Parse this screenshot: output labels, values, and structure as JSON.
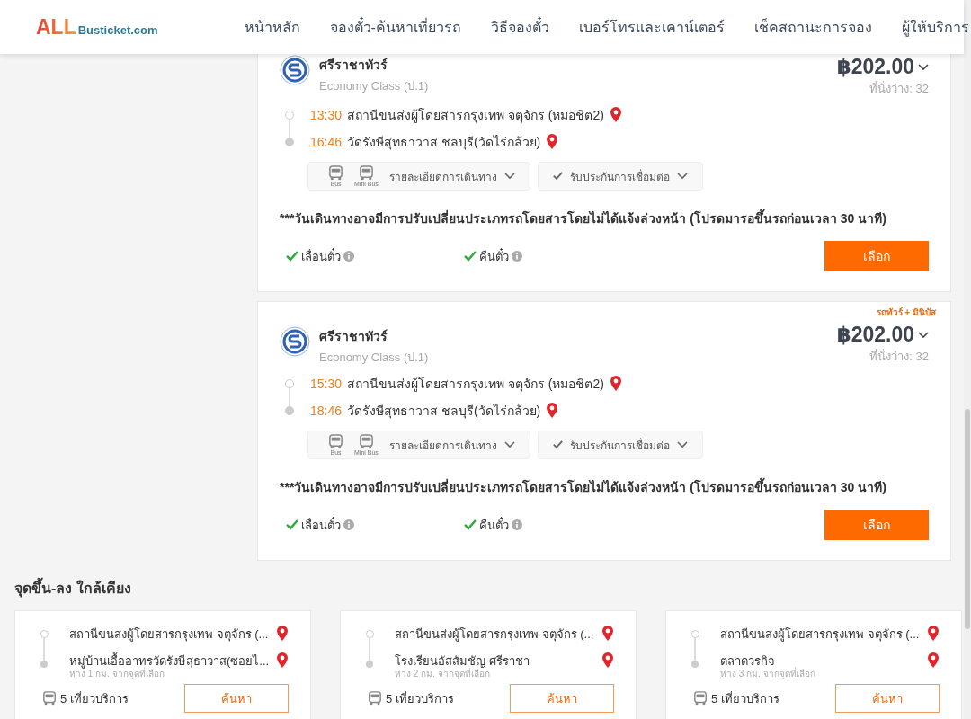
{
  "header": {
    "logo": {
      "brand": "ALL",
      "domain": "Busticket.com"
    },
    "nav": [
      "หน้าหลัก",
      "จองตั๋ว-ค้นหาเที่ยวรถ",
      "วิธีจองตั๋ว",
      "เบอร์โทรและเคาน์เตอร์",
      "เช็คสถานะการจอง",
      "ผู้ให้บริการ"
    ]
  },
  "trips": [
    {
      "operator": "ศรีราชาทัวร์",
      "class": "Economy Class (ป.1)",
      "price": "฿202.00",
      "seats": "ที่นั่งว่าง: 32",
      "stops": [
        {
          "time": "13:30",
          "place": "สถานีขนส่งผู้โดยสารกรุงเทพ จตุจักร (หมอชิต2)"
        },
        {
          "time": "16:46",
          "place": "วัดรังษีสุทธาวาส ชลบุรี(วัดไร่กล้วย)"
        }
      ],
      "vehicles": [
        "Bus",
        "Mini Bus"
      ],
      "details_label": "รายละเอียดการเดินทาง",
      "guarantee_label": "รับประกันการเชื่อมต่อ",
      "notice": "***วันเดินทางอาจมีการปรับเปลี่ยนประเภทรถโดยสารโดยไม่ได้แจ้งล่วงหน้า (โปรดมารอขึ้นรถก่อนเวลา 30 นาที)",
      "policies": [
        "เลื่อนตั๋ว",
        "คืนตั๋ว"
      ],
      "select_label": "เลือก"
    },
    {
      "tag": "รถทัวร์ + มินิบัส",
      "operator": "ศรีราชาทัวร์",
      "class": "Economy Class (ป.1)",
      "price": "฿202.00",
      "seats": "ที่นั่งว่าง: 32",
      "stops": [
        {
          "time": "15:30",
          "place": "สถานีขนส่งผู้โดยสารกรุงเทพ จตุจักร (หมอชิต2)"
        },
        {
          "time": "18:46",
          "place": "วัดรังษีสุทธาวาส ชลบุรี(วัดไร่กล้วย)"
        }
      ],
      "vehicles": [
        "Bus",
        "Mini Bus"
      ],
      "details_label": "รายละเอียดการเดินทาง",
      "guarantee_label": "รับประกันการเชื่อมต่อ",
      "notice": "***วันเดินทางอาจมีการปรับเปลี่ยนประเภทรถโดยสารโดยไม่ได้แจ้งล่วงหน้า (โปรดมารอขึ้นรถก่อนเวลา 30 นาที)",
      "policies": [
        "เลื่อนตั๋ว",
        "คืนตั๋ว"
      ],
      "select_label": "เลือก"
    }
  ],
  "nearby": {
    "title": "จุดขึ้น-ลง ใกล้เคียง",
    "items": [
      {
        "from": "สถานีขนส่งผู้โดยสารกรุงเทพ จตุจักร (...",
        "to": "หมู่บ้านเอื้ออาทรวัดรังษีสุธาวาส(ซอยไ...",
        "distance": "ห่าง 1 กม. จากจุดที่เลือก",
        "trips": "5 เที่ยวบริการ",
        "search_label": "ค้นหา"
      },
      {
        "from": "สถานีขนส่งผู้โดยสารกรุงเทพ จตุจักร (...",
        "to": "โรงเรียนอัสสัมชัญ ศรีราชา",
        "distance": "ห่าง 2 กม. จากจุดที่เลือก",
        "trips": "5 เที่ยวบริการ",
        "search_label": "ค้นหา"
      },
      {
        "from": "สถานีขนส่งผู้โดยสารกรุงเทพ จตุจักร (...",
        "to": "ตลาดวรกิจ",
        "distance": "ห่าง 3 กม. จากจุดที่เลือก",
        "trips": "5 เที่ยวบริการ",
        "search_label": "ค้นหา"
      }
    ]
  }
}
